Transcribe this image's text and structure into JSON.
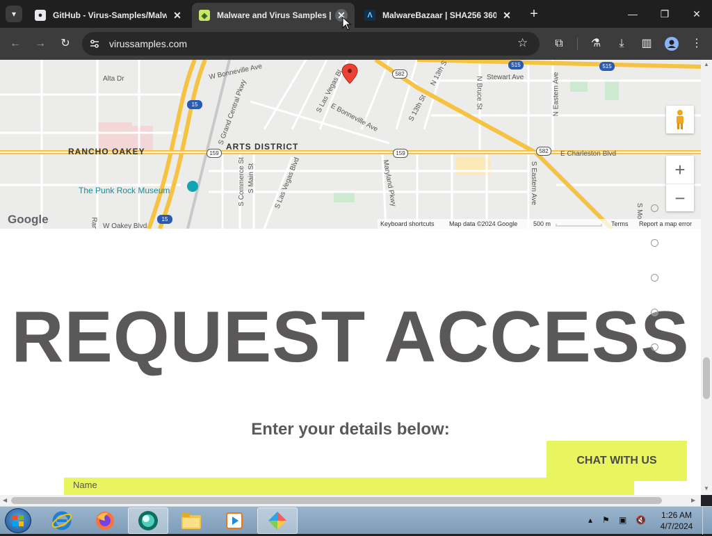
{
  "browser": {
    "tabs": [
      {
        "title": "GitHub - Virus-Samples/Malwa",
        "favicon": "github-icon",
        "active": false
      },
      {
        "title": "Malware and Virus Samples | V",
        "favicon": "site-icon",
        "active": true
      },
      {
        "title": "MalwareBazaar | SHA256 360e",
        "favicon": "malwarebazaar-icon",
        "active": false
      }
    ],
    "url": "virussamples.com"
  },
  "map": {
    "labels": {
      "alta_dr": "Alta Dr",
      "w_bonneville": "W Bonneville Ave",
      "grand_central": "S Grand Central Pkwy",
      "las_vegas_blvd_n": "S Las Vegas Bl",
      "e_bonneville": "E Bonneville Ave",
      "s_13th": "S 13th St",
      "n_13th": "N 13th S",
      "n_bruce": "N Bruce St",
      "stewart": "Stewart Ave",
      "n_eastern": "N Eastern Ave",
      "rancho_oakey": "RANCHO OAKEY",
      "arts_district": "ARTS DISTRICT",
      "e_charleston": "E Charleston Blvd",
      "punk_rock": "The Punk Rock Museum",
      "s_commerce": "S Commerce St",
      "s_main": "S Main St",
      "s_las_vegas_blvd": "S Las Vegas Blvd",
      "maryland": "Maryland Pkwy",
      "s_eastern": "S Eastern Ave",
      "w_oakey": "W Oakey Blvd",
      "ran": "Ran",
      "s_mo": "S Mo"
    },
    "shields": {
      "i15_a": "15",
      "i15_b": "15",
      "us95_a": "515",
      "us95_b": "515",
      "r582_a": "582",
      "r582_b": "582",
      "r159_a": "159",
      "r159_b": "159"
    },
    "footer": {
      "shortcuts": "Keyboard shortcuts",
      "data": "Map data ©2024 Google",
      "scale": "500 m",
      "terms": "Terms",
      "report": "Report a map error"
    },
    "logo": "Google",
    "zoom_in": "+",
    "zoom_out": "−"
  },
  "page": {
    "title": "REQUEST ACCESS",
    "subtitle": "Enter your details below:",
    "chat_button": "CHAT WITH US",
    "name_field_label": "Name"
  },
  "taskbar": {
    "time": "1:26 AM",
    "date": "4/7/2024"
  },
  "colors": {
    "accent_yellow": "#e8f55f",
    "heading_gray": "#5a5859",
    "map_road": "#f5c242"
  }
}
